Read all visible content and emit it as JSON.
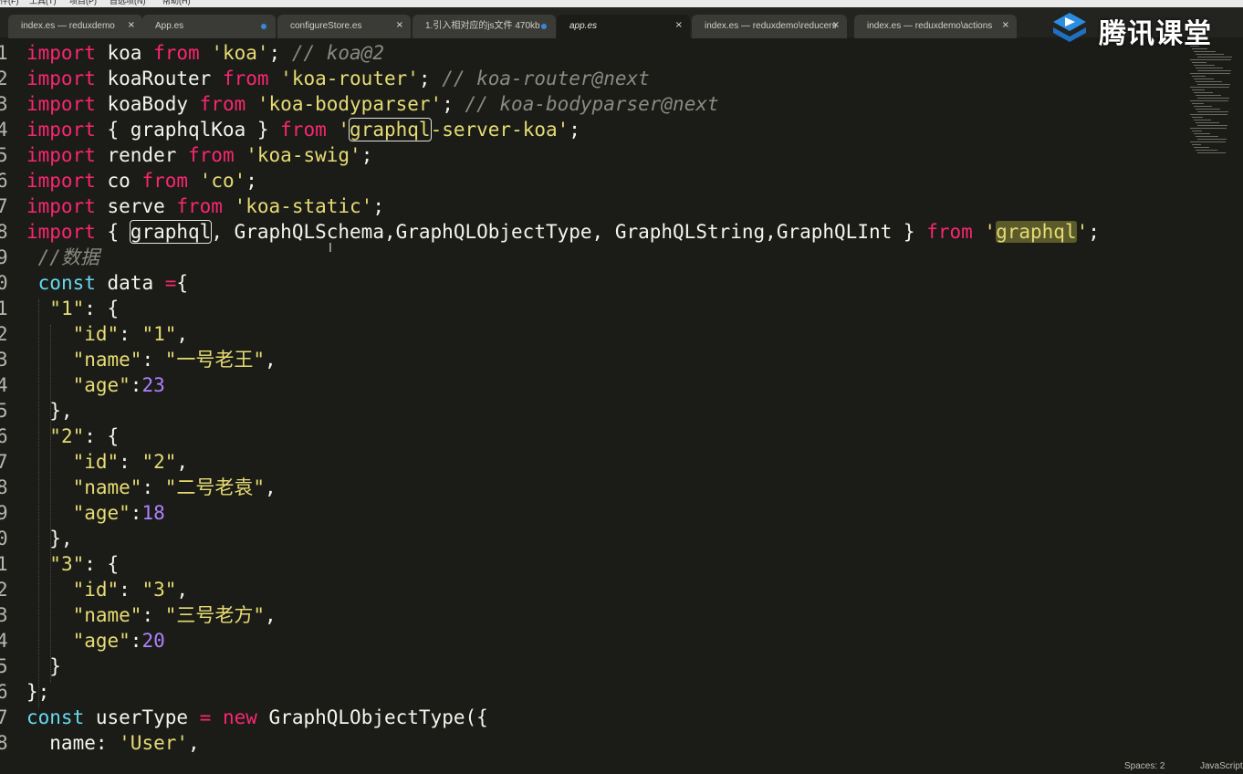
{
  "menu": [
    "件(F)",
    "工具(T)",
    "项目(P)",
    "首选项(N)",
    "帮助(H)"
  ],
  "tabs": [
    {
      "label": "index.es — reduxdemo",
      "close": "×",
      "dirty": false,
      "active": false
    },
    {
      "label": "App.es",
      "close": "",
      "dirty": true,
      "active": false
    },
    {
      "label": "configureStore.es",
      "close": "×",
      "dirty": false,
      "active": false
    },
    {
      "label": "1.引入相对应的js文件 470kb",
      "close": "",
      "dirty": true,
      "active": false
    },
    {
      "label": "app.es",
      "close": "×",
      "dirty": false,
      "active": true
    },
    {
      "label": "index.es — reduxdemo\\reducers",
      "close": "×",
      "dirty": false,
      "active": false
    },
    {
      "label": "index.es — reduxdemo\\actions",
      "close": "×",
      "dirty": false,
      "active": false
    }
  ],
  "watermark": {
    "text": "腾讯课堂",
    "icon": "tencent-classroom-logo-icon"
  },
  "code_lines": [
    {
      "num": "1",
      "tokens": [
        [
          "k",
          "import"
        ],
        [
          "p",
          " koa "
        ],
        [
          "k",
          "from"
        ],
        [
          "p",
          " "
        ],
        [
          "s",
          "'koa'"
        ],
        [
          "p",
          "; "
        ],
        [
          "c",
          "// koa@2"
        ]
      ]
    },
    {
      "num": "2",
      "tokens": [
        [
          "k",
          "import"
        ],
        [
          "p",
          " koaRouter "
        ],
        [
          "k",
          "from"
        ],
        [
          "p",
          " "
        ],
        [
          "s",
          "'koa-router'"
        ],
        [
          "p",
          "; "
        ],
        [
          "c",
          "// koa-router@next"
        ]
      ]
    },
    {
      "num": "3",
      "tokens": [
        [
          "k",
          "import"
        ],
        [
          "p",
          " koaBody "
        ],
        [
          "k",
          "from"
        ],
        [
          "p",
          " "
        ],
        [
          "s",
          "'koa-bodyparser'"
        ],
        [
          "p",
          "; "
        ],
        [
          "c",
          "// koa-bodyparser@next"
        ]
      ]
    },
    {
      "num": "4",
      "tokens": [
        [
          "k",
          "import"
        ],
        [
          "p",
          " { graphqlKoa } "
        ],
        [
          "k",
          "from"
        ],
        [
          "p",
          " "
        ],
        [
          "s",
          "'"
        ],
        [
          "sbox",
          "graphql"
        ],
        [
          "s",
          "-server-koa'"
        ],
        [
          "p",
          ";"
        ]
      ]
    },
    {
      "num": "5",
      "tokens": [
        [
          "k",
          "import"
        ],
        [
          "p",
          " render "
        ],
        [
          "k",
          "from"
        ],
        [
          "p",
          " "
        ],
        [
          "s",
          "'koa-swig'"
        ],
        [
          "p",
          ";"
        ]
      ]
    },
    {
      "num": "6",
      "tokens": [
        [
          "k",
          "import"
        ],
        [
          "p",
          " co "
        ],
        [
          "k",
          "from"
        ],
        [
          "p",
          " "
        ],
        [
          "s",
          "'co'"
        ],
        [
          "p",
          ";"
        ]
      ]
    },
    {
      "num": "7",
      "tokens": [
        [
          "k",
          "import"
        ],
        [
          "p",
          " serve "
        ],
        [
          "k",
          "from"
        ],
        [
          "p",
          " "
        ],
        [
          "s",
          "'koa-static'"
        ],
        [
          "p",
          ";"
        ]
      ]
    },
    {
      "num": "8",
      "tokens": [
        [
          "k",
          "import"
        ],
        [
          "p",
          " { "
        ],
        [
          "pbox",
          "graphql"
        ],
        [
          "p",
          ", GraphQLSchema,GraphQLObjectType, GraphQLString,GraphQLInt } "
        ],
        [
          "k",
          "from"
        ],
        [
          "p",
          " "
        ],
        [
          "s",
          "'"
        ],
        [
          "shl",
          "graphql"
        ],
        [
          "s",
          "'"
        ],
        [
          "p",
          ";"
        ]
      ]
    },
    {
      "num": "9",
      "tokens": [
        [
          "p",
          " "
        ],
        [
          "c",
          "//数据"
        ]
      ]
    },
    {
      "num": "0",
      "tokens": [
        [
          "p",
          " "
        ],
        [
          "b",
          "const"
        ],
        [
          "p",
          " data "
        ],
        [
          "k",
          "="
        ],
        [
          "p",
          "{"
        ]
      ]
    },
    {
      "num": "1",
      "tokens": [
        [
          "p",
          "  "
        ],
        [
          "s",
          "\"1\""
        ],
        [
          "p",
          ": {"
        ]
      ]
    },
    {
      "num": "2",
      "tokens": [
        [
          "p",
          "    "
        ],
        [
          "s",
          "\"id\""
        ],
        [
          "p",
          ": "
        ],
        [
          "s",
          "\"1\""
        ],
        [
          "p",
          ","
        ]
      ]
    },
    {
      "num": "3",
      "tokens": [
        [
          "p",
          "    "
        ],
        [
          "s",
          "\"name\""
        ],
        [
          "p",
          ": "
        ],
        [
          "s",
          "\"一号老王\""
        ],
        [
          "p",
          ","
        ]
      ]
    },
    {
      "num": "4",
      "tokens": [
        [
          "p",
          "    "
        ],
        [
          "s",
          "\"age\""
        ],
        [
          "p",
          ":"
        ],
        [
          "n",
          "23"
        ]
      ]
    },
    {
      "num": "5",
      "tokens": [
        [
          "p",
          "  },"
        ]
      ]
    },
    {
      "num": "6",
      "tokens": [
        [
          "p",
          "  "
        ],
        [
          "s",
          "\"2\""
        ],
        [
          "p",
          ": {"
        ]
      ]
    },
    {
      "num": "7",
      "tokens": [
        [
          "p",
          "    "
        ],
        [
          "s",
          "\"id\""
        ],
        [
          "p",
          ": "
        ],
        [
          "s",
          "\"2\""
        ],
        [
          "p",
          ","
        ]
      ]
    },
    {
      "num": "8",
      "tokens": [
        [
          "p",
          "    "
        ],
        [
          "s",
          "\"name\""
        ],
        [
          "p",
          ": "
        ],
        [
          "s",
          "\"二号老袁\""
        ],
        [
          "p",
          ","
        ]
      ]
    },
    {
      "num": "9",
      "tokens": [
        [
          "p",
          "    "
        ],
        [
          "s",
          "\"age\""
        ],
        [
          "p",
          ":"
        ],
        [
          "n",
          "18"
        ]
      ]
    },
    {
      "num": "0",
      "tokens": [
        [
          "p",
          "  },"
        ]
      ]
    },
    {
      "num": "1",
      "tokens": [
        [
          "p",
          "  "
        ],
        [
          "s",
          "\"3\""
        ],
        [
          "p",
          ": {"
        ]
      ]
    },
    {
      "num": "2",
      "tokens": [
        [
          "p",
          "    "
        ],
        [
          "s",
          "\"id\""
        ],
        [
          "p",
          ": "
        ],
        [
          "s",
          "\"3\""
        ],
        [
          "p",
          ","
        ]
      ]
    },
    {
      "num": "3",
      "tokens": [
        [
          "p",
          "    "
        ],
        [
          "s",
          "\"name\""
        ],
        [
          "p",
          ": "
        ],
        [
          "s",
          "\"三号老方\""
        ],
        [
          "p",
          ","
        ]
      ]
    },
    {
      "num": "4",
      "tokens": [
        [
          "p",
          "    "
        ],
        [
          "s",
          "\"age\""
        ],
        [
          "p",
          ":"
        ],
        [
          "n",
          "20"
        ]
      ]
    },
    {
      "num": "5",
      "tokens": [
        [
          "p",
          "  }"
        ]
      ]
    },
    {
      "num": "6",
      "tokens": [
        [
          "p",
          "};"
        ]
      ]
    },
    {
      "num": "7",
      "tokens": [
        [
          "b",
          "const"
        ],
        [
          "p",
          " userType "
        ],
        [
          "k",
          "="
        ],
        [
          "p",
          " "
        ],
        [
          "k",
          "new"
        ],
        [
          "p",
          " GraphQLObjectType({"
        ]
      ]
    },
    {
      "num": "8",
      "tokens": [
        [
          "p",
          "  name: "
        ],
        [
          "s",
          "'User'"
        ],
        [
          "p",
          ","
        ]
      ]
    }
  ],
  "status": {
    "spaces": "Spaces: 2",
    "syntax": "JavaScript"
  },
  "colors": {
    "keyword": "#f92672",
    "string": "#e6db74",
    "comment": "#8b8a82",
    "number": "#ae81ff",
    "storage": "#66d9ef",
    "background": "#1b1c17"
  }
}
